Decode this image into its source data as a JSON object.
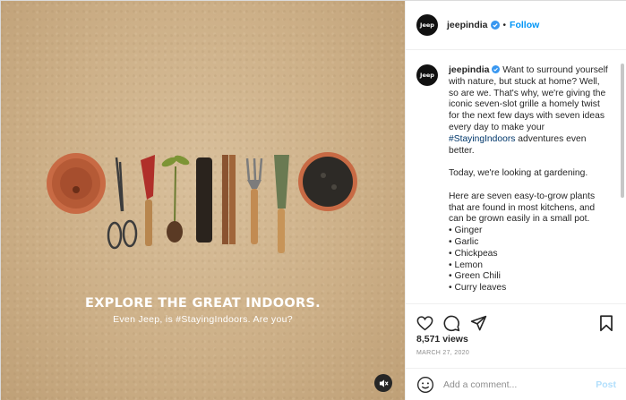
{
  "media": {
    "headline": "EXPLORE THE GREAT INDOORS.",
    "subline": "Even Jeep, is #StayingIndoors. Are you?"
  },
  "header": {
    "avatar_text": "Jeep",
    "username": "jeepindia",
    "separator": "•",
    "follow_label": "Follow"
  },
  "caption": {
    "username": "jeepindia",
    "text_intro": "Want to surround yourself with nature, but stuck at home? Well, so are we. That's why, we're giving the iconic seven-slot grille a homely twist for the next few days with seven ideas every day to make your ",
    "hashtag": "#StayingIndoors",
    "text_outro": " adventures even better.",
    "para2": "Today, we're looking at gardening.",
    "para3": "Here are seven easy-to-grow plants that are found in most kitchens, and can be grown easily in a small pot.",
    "list": [
      "• Ginger",
      "• Garlic",
      "• Chickpeas",
      "• Lemon",
      "• Green Chili",
      "• Curry leaves"
    ]
  },
  "stats": {
    "views": "8,571 views",
    "date": "MARCH 27, 2020"
  },
  "comment_box": {
    "placeholder": "Add a comment...",
    "post_label": "Post"
  },
  "colors": {
    "accent": "#0095f6",
    "hashtag": "#00376b",
    "post_disabled": "#b2dffc"
  },
  "icons": [
    "verified-badge-icon",
    "heart-icon",
    "comment-icon",
    "share-icon",
    "bookmark-icon",
    "emoji-icon",
    "mute-icon"
  ]
}
